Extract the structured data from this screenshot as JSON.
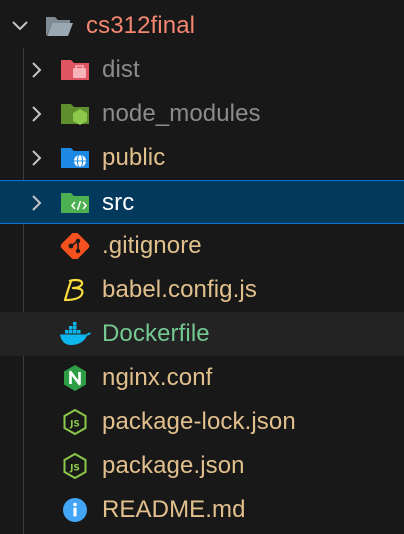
{
  "explorer": {
    "root": {
      "name": "cs312final",
      "color": "#f48771",
      "icon": "folder-open-icon"
    },
    "items": [
      {
        "name": "dist",
        "type": "folder",
        "color": "#8b8b8b",
        "icon": "folder-dist-icon",
        "expanded": false
      },
      {
        "name": "node_modules",
        "type": "folder",
        "color": "#8b8b8b",
        "icon": "folder-node-icon",
        "expanded": false
      },
      {
        "name": "public",
        "type": "folder",
        "color": "#e2c08d",
        "icon": "folder-public-icon",
        "expanded": false
      },
      {
        "name": "src",
        "type": "folder",
        "color": "#ffffff",
        "icon": "folder-src-icon",
        "expanded": false,
        "selected": true
      },
      {
        "name": ".gitignore",
        "type": "file",
        "color": "#e2c08d",
        "icon": "git-icon"
      },
      {
        "name": "babel.config.js",
        "type": "file",
        "color": "#e2c08d",
        "icon": "babel-icon"
      },
      {
        "name": "Dockerfile",
        "type": "file",
        "color": "#73c991",
        "icon": "docker-icon"
      },
      {
        "name": "nginx.conf",
        "type": "file",
        "color": "#e2c08d",
        "icon": "nginx-icon"
      },
      {
        "name": "package-lock.json",
        "type": "file",
        "color": "#e2c08d",
        "icon": "nodejs-icon"
      },
      {
        "name": "package.json",
        "type": "file",
        "color": "#e2c08d",
        "icon": "nodejs-icon"
      },
      {
        "name": "README.md",
        "type": "file",
        "color": "#e2c08d",
        "icon": "info-icon"
      }
    ]
  }
}
